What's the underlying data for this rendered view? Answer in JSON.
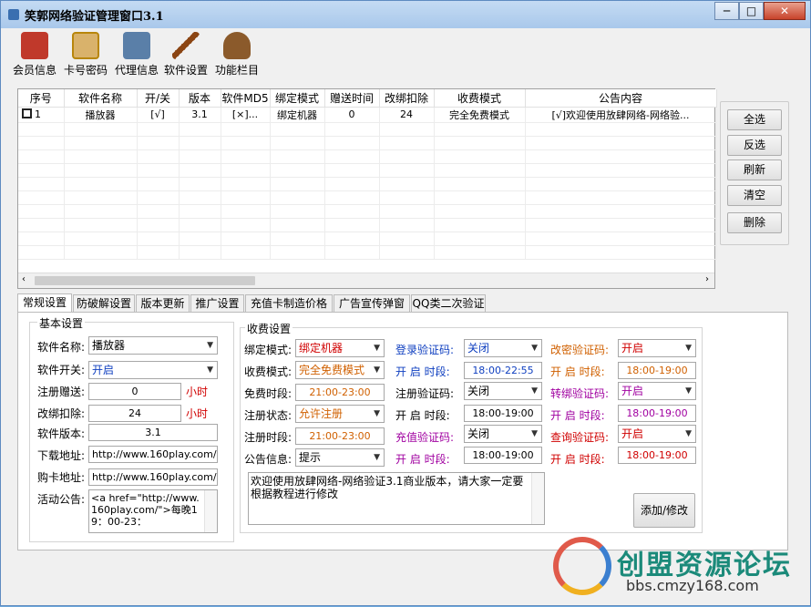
{
  "window": {
    "title": "笑郭网络验证管理窗口3.1",
    "min": "─",
    "max": "□",
    "close": "✕"
  },
  "toolbar": [
    {
      "label": "会员信息",
      "icon": "temple-icon",
      "color": "#c0392b"
    },
    {
      "label": "卡号密码",
      "icon": "scroll-icon",
      "color": "#b8860b"
    },
    {
      "label": "代理信息",
      "icon": "jar-icon",
      "color": "#5a7fa8"
    },
    {
      "label": "软件设置",
      "icon": "brush-icon",
      "color": "#8b4513"
    },
    {
      "label": "功能栏目",
      "icon": "cauldron-icon",
      "color": "#8b5a2b"
    }
  ],
  "table": {
    "columns": [
      "序号",
      "软件名称",
      "开/关",
      "版本",
      "软件MD5",
      "绑定模式",
      "赠送时间",
      "改绑扣除",
      "收费模式",
      "公告内容"
    ],
    "rows": [
      [
        "1",
        "播放器",
        "[√]",
        "3.1",
        "[×]...",
        "绑定机器",
        "0",
        "24",
        "完全免费模式",
        "[√]欢迎使用放肆网络-网络验..."
      ]
    ]
  },
  "side_buttons": [
    "全选",
    "反选",
    "刷新",
    "清空",
    "删除"
  ],
  "tabs": [
    "常规设置",
    "防破解设置",
    "版本更新",
    "推广设置",
    "充值卡制造价格",
    "广告宣传弹窗",
    "QQ类二次验证"
  ],
  "basic": {
    "group_title": "基本设置",
    "name_label": "软件名称:",
    "name_value": "播放器",
    "switch_label": "软件开关:",
    "switch_value": "开启",
    "gift_label": "注册赠送:",
    "gift_value": "0",
    "gift_unit": "小时",
    "rebind_label": "改绑扣除:",
    "rebind_value": "24",
    "rebind_unit": "小时",
    "version_label": "软件版本:",
    "version_value": "3.1",
    "download_label": "下载地址:",
    "download_value": "http://www.160play.com/",
    "buy_label": "购卡地址:",
    "buy_value": "http://www.160play.com/",
    "notice_label": "活动公告:",
    "notice_value": "<a href=\"http://www.160play.com/\">每晚19：00-23："
  },
  "charge": {
    "group_title": "收费设置",
    "bind_label": "绑定模式:",
    "bind_value": "绑定机器",
    "fee_label": "收费模式:",
    "fee_value": "完全免费模式",
    "free_label": "免费时段:",
    "free_value": "21:00-23:00",
    "reg_state_label": "注册状态:",
    "reg_state_value": "允许注册",
    "reg_time_label": "注册时段:",
    "reg_time_value": "21:00-23:00",
    "notice_label": "公告信息:",
    "notice_value": "提示",
    "login_code_label": "登录验证码:",
    "login_code_value": "关闭",
    "login_time_label": "开 启 时段:",
    "login_time_value": "18:00-22:55",
    "reg_code_label": "注册验证码:",
    "reg_code_value": "关闭",
    "reg_code_time_label": "开 启 时段:",
    "reg_code_time_value": "18:00-19:00",
    "recharge_code_label": "充值验证码:",
    "recharge_code_value": "关闭",
    "recharge_time_label": "开 启 时段:",
    "recharge_time_value": "18:00-19:00",
    "pwd_code_label": "改密验证码:",
    "pwd_code_value": "开启",
    "pwd_time_label": "开 启 时段:",
    "pwd_time_value": "18:00-19:00",
    "transfer_code_label": "转绑验证码:",
    "transfer_code_value": "开启",
    "transfer_time_label": "开 启 时段:",
    "transfer_time_value": "18:00-19:00",
    "query_code_label": "查询验证码:",
    "query_code_value": "开启",
    "query_time_label": "开 启 时段:",
    "query_time_value": "18:00-19:00",
    "notice_text": "欢迎使用放肆网络-网络验证3.1商业版本，请大家一定要根据教程进行修改",
    "add_button": "添加/修改"
  },
  "watermark": {
    "big": "创盟资源论坛",
    "small": "bbs.cmzy168.com"
  }
}
